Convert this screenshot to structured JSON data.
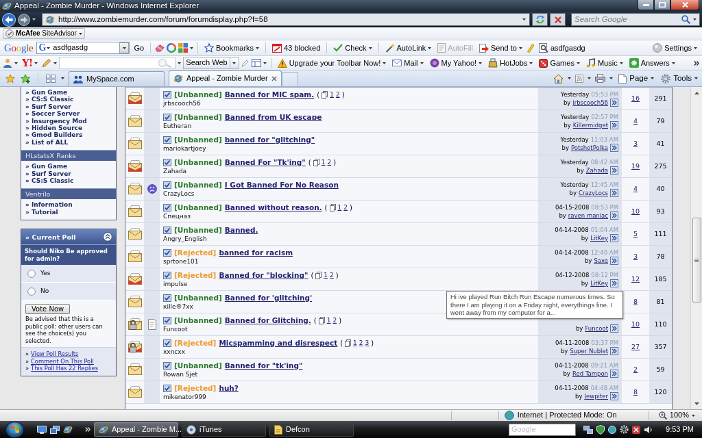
{
  "window": {
    "title": "Appeal - Zombie Murder - Windows Internet Explorer"
  },
  "address_bar": {
    "url": "http://www.zombiemurder.com/forum/forumdisplay.php?f=58",
    "search": {
      "placeholder": "Search Google"
    }
  },
  "mcafee_bar": {
    "label": "**McAfee** SiteAdvisor"
  },
  "google_toolbar": {
    "logo": "Google",
    "engine": "G",
    "query": "asdfgasdg",
    "go": "Go",
    "items": [
      {
        "label": "Bookmarks",
        "dropdown": true,
        "disabled": false
      },
      {
        "label": "43 blocked",
        "dropdown": false,
        "disabled": false
      },
      {
        "label": "Check",
        "dropdown": true,
        "disabled": false
      },
      {
        "label": "AutoLink",
        "dropdown": true,
        "disabled": false
      },
      {
        "label": "AutoFill",
        "dropdown": false,
        "disabled": true
      },
      {
        "label": "Send to",
        "dropdown": true,
        "disabled": false
      }
    ],
    "highlight_term": "asdfgasdg",
    "settings": "Settings"
  },
  "yahoo_toolbar": {
    "logo": "Y!",
    "search_button": "Search Web",
    "links": [
      {
        "label": "Upgrade your Toolbar Now!"
      },
      {
        "label": "Mail"
      },
      {
        "label": "My Yahoo!"
      },
      {
        "label": "HotJobs"
      },
      {
        "label": "Games"
      },
      {
        "label": "Music"
      },
      {
        "label": "Answers"
      }
    ]
  },
  "tabs": [
    {
      "label": "MySpace.com",
      "selected": false
    },
    {
      "label": "Appeal - Zombie Murder",
      "selected": true
    }
  ],
  "command_bar": {
    "buttons": [
      {
        "label": "Page"
      },
      {
        "label": "Tools"
      }
    ]
  },
  "sidebar": {
    "sections": [
      {
        "links": [
          "» Gun Game",
          "» CS:S Classic",
          "» Surf Server",
          "» Soccer Server",
          "» Insurgency Mod",
          "» Hidden Source",
          "» Gmod Builders",
          "» List of ALL"
        ]
      },
      {
        "header": "HLstatsX Ranks",
        "links": [
          "» Gun Game",
          "» Surf Server",
          "» CS:S Classic"
        ]
      },
      {
        "header": "Ventrilo",
        "links": [
          "» Information",
          "» Tutorial"
        ]
      }
    ]
  },
  "poll": {
    "title": "» Current Poll",
    "question": "Should Niko Be approved for admin?",
    "options": [
      {
        "label": "Yes",
        "selected": false
      },
      {
        "label": "No",
        "selected": false
      }
    ],
    "vote_button": "Vote Now",
    "notice": "Be advised that this is a public poll: other users can see the choice(s) you selected.",
    "links": [
      {
        "bullet": "»",
        "text": "View Poll Results"
      },
      {
        "bullet": "»",
        "text": "Comment On This Poll"
      },
      {
        "bullet": "»",
        "text": "This Poll Has 22 Replies"
      }
    ]
  },
  "threads": [
    {
      "hot": true,
      "locked": false,
      "prefix": {
        "kind": "unbanned",
        "text": "[Unbanned]"
      },
      "title": "Banned for MIC spam.",
      "pages": {
        "open": "(",
        "numbers": [
          "1",
          "2"
        ],
        "close": ")"
      },
      "author": "jrbscooch56",
      "last_post": {
        "date": "Yesterday",
        "time": "05:53 PM",
        "by": "by",
        "user": "jrbscooch56"
      },
      "replies": "16",
      "views": "291"
    },
    {
      "hot": false,
      "locked": false,
      "prefix": {
        "kind": "unbanned",
        "text": "[Unbanned]"
      },
      "title": "Banned from UK escape",
      "author": "Eutheran",
      "last_post": {
        "date": "Yesterday",
        "time": "02:57 PM",
        "by": "by",
        "user": "Killermidget"
      },
      "replies": "4",
      "views": "79"
    },
    {
      "hot": false,
      "locked": false,
      "prefix": {
        "kind": "unbanned",
        "text": "[Unbanned]"
      },
      "title": "banned for \"glitching\"",
      "author": "mariokartjoey",
      "last_post": {
        "date": "Yesterday",
        "time": "11:03 AM",
        "by": "by",
        "user": "PotshotPolka"
      },
      "replies": "3",
      "views": "41"
    },
    {
      "hot": true,
      "locked": false,
      "prefix": {
        "kind": "unbanned",
        "text": "[Unbanned]"
      },
      "title": "Banned For \"Tk'ing\"",
      "pages": {
        "open": "(",
        "numbers": [
          "1",
          "2"
        ],
        "close": ")"
      },
      "author": "Zahada",
      "last_post": {
        "date": "Yesterday",
        "time": "08:42 AM",
        "by": "by",
        "user": "Zahada"
      },
      "replies": "19",
      "views": "275"
    },
    {
      "hot": false,
      "locked": false,
      "post_icon": {
        "kind": "frown"
      },
      "prefix": {
        "kind": "unbanned",
        "text": "[Unbanned]"
      },
      "title": "I Got Banned For No Reason",
      "author": "CrazyLocs",
      "last_post": {
        "date": "Yesterday",
        "time": "12:45 AM",
        "by": "by",
        "user": "CrazyLocs"
      },
      "replies": "4",
      "views": "40"
    },
    {
      "hot": false,
      "locked": false,
      "prefix": {
        "kind": "unbanned",
        "text": "[Unbanned]"
      },
      "title": "Banned without reason.",
      "pages": {
        "open": "(",
        "numbers": [
          "1",
          "2"
        ],
        "close": ")"
      },
      "author": "Спецназ",
      "last_post": {
        "date": "04-15-2008",
        "time": "08:53 PM",
        "by": "by",
        "user": "raven maniac"
      },
      "replies": "10",
      "views": "93"
    },
    {
      "hot": false,
      "locked": false,
      "prefix": {
        "kind": "unbanned",
        "text": "[Unbanned]"
      },
      "title": "Banned.",
      "author": "Angry_English",
      "last_post": {
        "date": "04-14-2008",
        "time": "01:04 AM",
        "by": "by",
        "user": "LitKey"
      },
      "replies": "5",
      "views": "111"
    },
    {
      "hot": false,
      "locked": false,
      "prefix": {
        "kind": "rejected",
        "text": "[Rejected]"
      },
      "title": "banned for racism",
      "author": "sprtone101",
      "last_post": {
        "date": "04-14-2008",
        "time": "12:40 AM",
        "by": "by",
        "user": "Saxe"
      },
      "replies": "3",
      "views": "78"
    },
    {
      "hot": true,
      "locked": false,
      "prefix": {
        "kind": "rejected",
        "text": "[Rejected]"
      },
      "title": "Banned for \"blocking\"",
      "pages": {
        "open": "(",
        "numbers": [
          "1",
          "2"
        ],
        "close": ")"
      },
      "author": "impulse",
      "last_post": {
        "date": "04-12-2008",
        "time": "08:12 PM",
        "by": "by",
        "user": "LitKey"
      },
      "replies": "12",
      "views": "185"
    },
    {
      "hot": false,
      "locked": false,
      "prefix": {
        "kind": "unbanned",
        "text": "[Unbanned]"
      },
      "title": "Banned for 'glitching'",
      "author": "кille®7xx",
      "replies": "8",
      "views": "81"
    },
    {
      "hot": false,
      "locked": true,
      "post_icon": {
        "kind": "note"
      },
      "prefix": {
        "kind": "unbanned",
        "text": "[Unbanned]"
      },
      "title": "Banned for Glitching.",
      "pages": {
        "open": "(",
        "numbers": [
          "1",
          "2"
        ],
        "close": ")"
      },
      "author": "Funcoot",
      "last_post": {
        "by": "by",
        "user": "Funcoot"
      },
      "replies": "10",
      "views": "110"
    },
    {
      "hot": true,
      "locked": true,
      "prefix": {
        "kind": "rejected",
        "text": "[Rejected]"
      },
      "title": "Micspamming and disrespect",
      "pages": {
        "open": "(",
        "numbers": [
          "1",
          "2",
          "3"
        ],
        "close": ")"
      },
      "author": "xxncxx",
      "last_post": {
        "date": "04-11-2008",
        "time": "03:37 PM",
        "by": "by",
        "user": "Super Nublet"
      },
      "replies": "27",
      "views": "357"
    },
    {
      "hot": false,
      "locked": false,
      "prefix": {
        "kind": "unbanned",
        "text": "[Unbanned]"
      },
      "title": "Banned for \"tk'ing\"",
      "author": "Rowan Sjet",
      "last_post": {
        "date": "04-11-2008",
        "time": "09:21 AM",
        "by": "by",
        "user": "Red Tampon"
      },
      "replies": "2",
      "views": "59"
    },
    {
      "hot": false,
      "locked": false,
      "prefix": {
        "kind": "rejected",
        "text": "[Rejected]"
      },
      "title": "huh?",
      "author": "mikenator999",
      "last_post": {
        "date": "04-11-2008",
        "time": "04:48 AM",
        "by": "by",
        "user": "Jewpiter"
      },
      "replies": "8",
      "views": "120"
    }
  ],
  "tooltip": {
    "text": "Hi ive played Run Bitch Run Escape numerous times. So there I am playing it on a Friday night, everythings fine. I went away from my computer for a..."
  },
  "status_bar": {
    "zone": "Internet | Protected Mode: On",
    "zoom": "100%"
  },
  "taskbar": {
    "tasks": [
      {
        "label": "Appeal - Zombie M...",
        "selected": true
      },
      {
        "label": "iTunes",
        "selected": false
      },
      {
        "label": "Defcon",
        "selected": false
      }
    ],
    "search": {
      "placeholder": "Google"
    },
    "clock": "9:53 PM"
  }
}
